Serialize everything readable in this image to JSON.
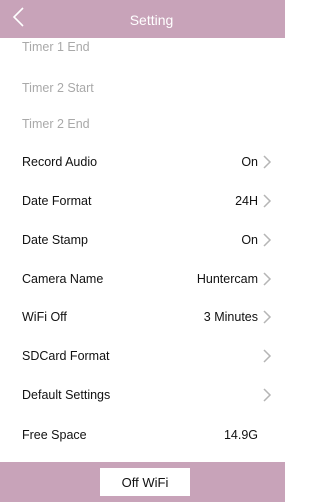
{
  "header": {
    "title": "Setting",
    "back_icon": "chevron-left-icon"
  },
  "settings": [
    {
      "label": "Timer 1 End",
      "value": "",
      "chevron": false,
      "disabled": true
    },
    {
      "label": "Timer 2 Start",
      "value": "",
      "chevron": false,
      "disabled": true
    },
    {
      "label": "Timer 2 End",
      "value": "",
      "chevron": false,
      "disabled": true
    },
    {
      "label": "Record Audio",
      "value": "On",
      "chevron": true,
      "disabled": false
    },
    {
      "label": "Date Format",
      "value": "24H",
      "chevron": true,
      "disabled": false
    },
    {
      "label": "Date Stamp",
      "value": "On",
      "chevron": true,
      "disabled": false
    },
    {
      "label": "Camera Name",
      "value": "Huntercam",
      "chevron": true,
      "disabled": false
    },
    {
      "label": "WiFi Off",
      "value": "3 Minutes",
      "chevron": true,
      "disabled": false
    },
    {
      "label": "SDCard Format",
      "value": "",
      "chevron": true,
      "disabled": false
    },
    {
      "label": "Default Settings",
      "value": "",
      "chevron": true,
      "disabled": false
    },
    {
      "label": "Free Space",
      "value": "14.9G",
      "chevron": false,
      "disabled": false
    }
  ],
  "footer": {
    "off_wifi_label": "Off WiFi"
  },
  "colors": {
    "accent": "#c8a3b9",
    "text": "#111111",
    "disabled_text": "#a9a9a9",
    "chevron": "#b5b5b5"
  }
}
